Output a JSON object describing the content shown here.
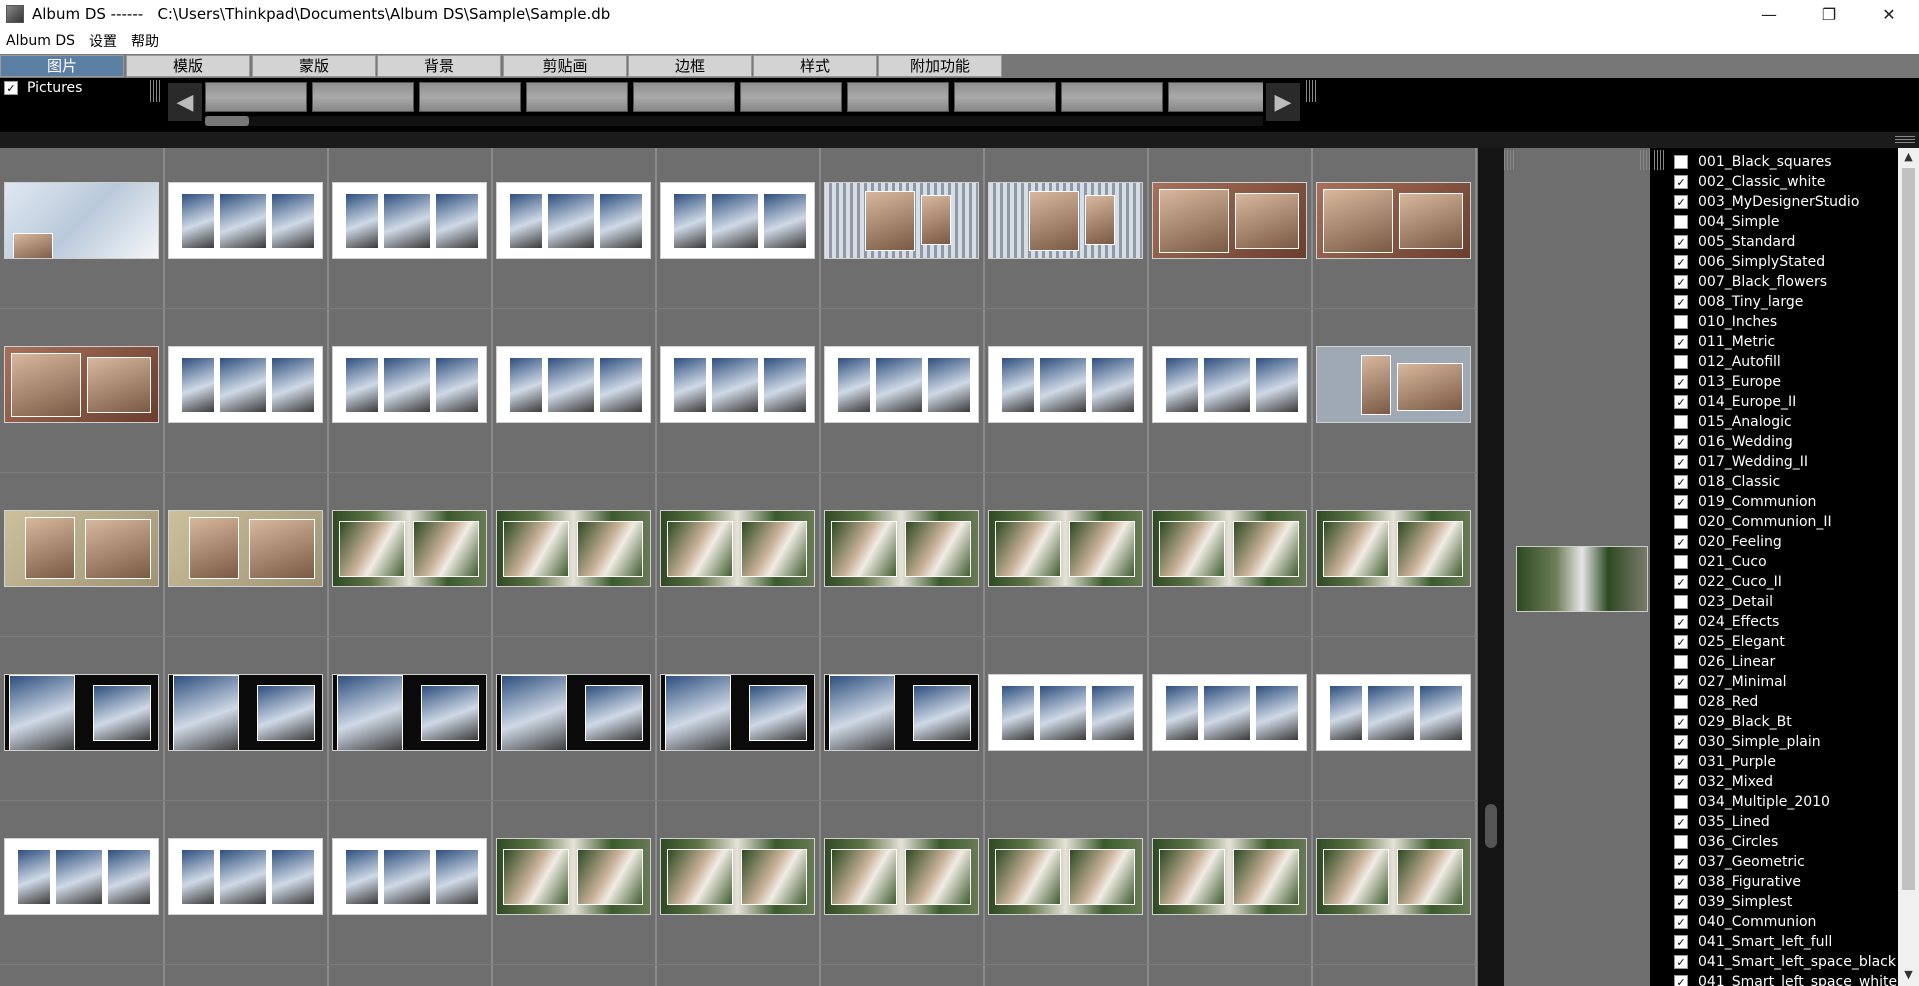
{
  "window": {
    "title": "Album DS ------   C:\\Users\\Thinkpad\\Documents\\Album DS\\Sample\\Sample.db",
    "min_icon": "minimize-icon",
    "max_icon": "maximize-icon",
    "close_icon": "close-icon"
  },
  "menu": [
    "Album DS",
    "设置",
    "帮助"
  ],
  "tabs": [
    {
      "label": "图片",
      "active": true
    },
    {
      "label": "模版",
      "active": false
    },
    {
      "label": "蒙版",
      "active": false
    },
    {
      "label": "背景",
      "active": false
    },
    {
      "label": "剪贴画",
      "active": false
    },
    {
      "label": "边框",
      "active": false
    },
    {
      "label": "样式",
      "active": false
    },
    {
      "label": "附加功能",
      "active": false
    }
  ],
  "filmstrip": {
    "pictures_label": "Pictures",
    "pictures_checked": true,
    "thumb_count": 10
  },
  "grid": {
    "rows": [
      [
        "light",
        "white",
        "white",
        "white",
        "white",
        "striped",
        "striped",
        "brown",
        "brown"
      ],
      [
        "brown",
        "white",
        "white",
        "white",
        "white",
        "white",
        "white",
        "white",
        "blue-gray"
      ],
      [
        "beige",
        "beige",
        "green",
        "green",
        "green",
        "green",
        "green",
        "green",
        "green"
      ],
      [
        "black",
        "black",
        "black",
        "black",
        "black",
        "black",
        "white",
        "white",
        "white"
      ],
      [
        "white",
        "white",
        "white",
        "green",
        "green",
        "green",
        "green",
        "green",
        "green"
      ]
    ]
  },
  "styles": [
    {
      "label": "001_Black_squares",
      "checked": false
    },
    {
      "label": "002_Classic_white",
      "checked": true
    },
    {
      "label": "003_MyDesignerStudio",
      "checked": true
    },
    {
      "label": "004_Simple",
      "checked": false
    },
    {
      "label": "005_Standard",
      "checked": true
    },
    {
      "label": "006_SimplyStated",
      "checked": true
    },
    {
      "label": "007_Black_flowers",
      "checked": true
    },
    {
      "label": "008_Tiny_large",
      "checked": true
    },
    {
      "label": "010_Inches",
      "checked": false
    },
    {
      "label": "011_Metric",
      "checked": true
    },
    {
      "label": "012_Autofill",
      "checked": false
    },
    {
      "label": "013_Europe",
      "checked": true
    },
    {
      "label": "014_Europe_II",
      "checked": true
    },
    {
      "label": "015_Analogic",
      "checked": false
    },
    {
      "label": "016_Wedding",
      "checked": true
    },
    {
      "label": "017_Wedding_II",
      "checked": true
    },
    {
      "label": "018_Classic",
      "checked": true
    },
    {
      "label": "019_Communion",
      "checked": true
    },
    {
      "label": "020_Communion_II",
      "checked": false
    },
    {
      "label": "020_Feeling",
      "checked": true
    },
    {
      "label": "021_Cuco",
      "checked": false
    },
    {
      "label": "022_Cuco_II",
      "checked": true
    },
    {
      "label": "023_Detail",
      "checked": false
    },
    {
      "label": "024_Effects",
      "checked": true
    },
    {
      "label": "025_Elegant",
      "checked": true
    },
    {
      "label": "026_Linear",
      "checked": false
    },
    {
      "label": "027_Minimal",
      "checked": true
    },
    {
      "label": "028_Red",
      "checked": false
    },
    {
      "label": "029_Black_Bt",
      "checked": true
    },
    {
      "label": "030_Simple_plain",
      "checked": true
    },
    {
      "label": "031_Purple",
      "checked": true
    },
    {
      "label": "032_Mixed",
      "checked": true
    },
    {
      "label": "034_Multiple_2010",
      "checked": false
    },
    {
      "label": "035_Lined",
      "checked": true
    },
    {
      "label": "036_Circles",
      "checked": false
    },
    {
      "label": "037_Geometric",
      "checked": true
    },
    {
      "label": "038_Figurative",
      "checked": true
    },
    {
      "label": "039_Simplest",
      "checked": true
    },
    {
      "label": "040_Communion",
      "checked": true
    },
    {
      "label": "041_Smart_left_full",
      "checked": true
    },
    {
      "label": "041_Smart_left_space_black",
      "checked": true
    },
    {
      "label": "041_Smart_left_space_white",
      "checked": true
    }
  ],
  "colors": {
    "active_tab": "#5b7fa3",
    "grid_bg": "#6e6e6e",
    "list_bg": "#000000"
  }
}
